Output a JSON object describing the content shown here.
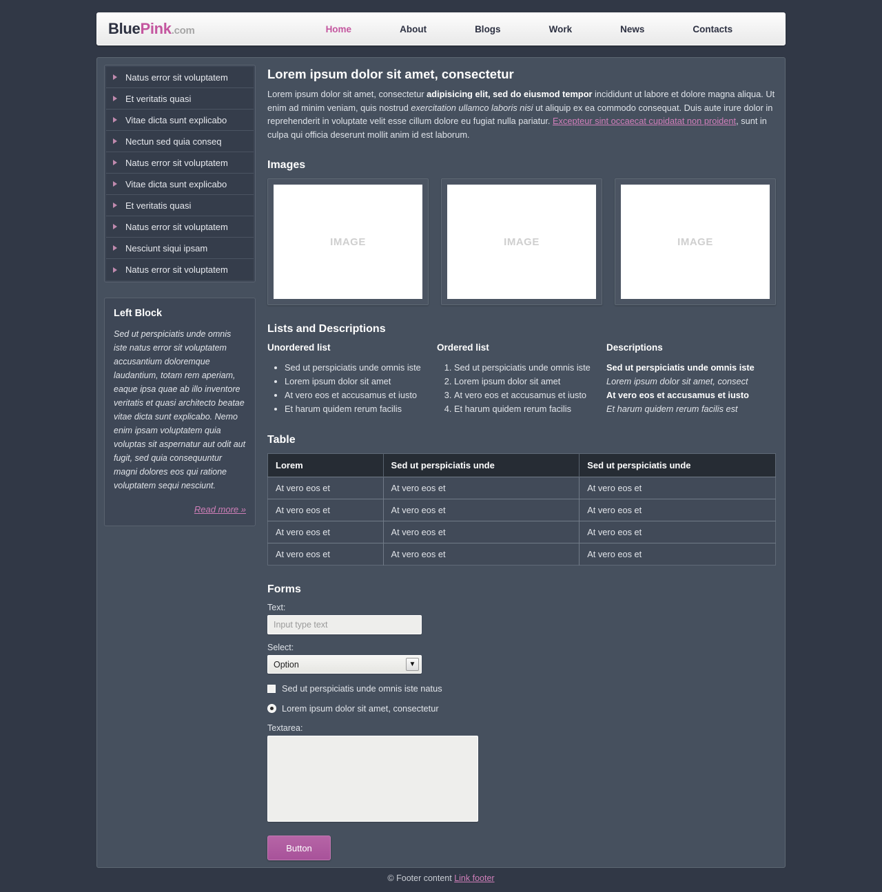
{
  "header": {
    "logo": {
      "blue": "Blue",
      "pink": "Pink",
      "com": ".com"
    },
    "nav": [
      {
        "label": "Home",
        "active": true
      },
      {
        "label": "About",
        "active": false
      },
      {
        "label": "Blogs",
        "active": false
      },
      {
        "label": "Work",
        "active": false
      },
      {
        "label": "News",
        "active": false
      },
      {
        "label": "Contacts",
        "active": false
      }
    ]
  },
  "sidebar": {
    "menu": [
      "Natus error sit voluptatem",
      "Et veritatis quasi",
      "Vitae dicta sunt explicabo",
      "Nectun sed quia conseq",
      "Natus error sit voluptatem",
      "Vitae dicta sunt explicabo",
      "Et veritatis quasi",
      "Natus error sit voluptatem",
      "Nesciunt siqui ipsam",
      "Natus error sit voluptatem"
    ],
    "left_block": {
      "title": "Left Block",
      "text": "Sed ut perspiciatis unde omnis iste natus error sit voluptatem accusantium doloremque laudantium, totam rem aperiam, eaque ipsa quae ab illo inventore veritatis et quasi architecto beatae vitae dicta sunt explicabo. Nemo enim ipsam voluptatem quia voluptas sit aspernatur aut odit aut fugit, sed quia consequuntur magni dolores eos qui ratione voluptatem sequi nesciunt.",
      "read_more": "Read more »"
    }
  },
  "content": {
    "title": "Lorem ipsum dolor sit amet, consectetur",
    "intro": {
      "part1": "Lorem ipsum dolor sit amet, consectetur ",
      "bold": "adipisicing elit, sed do eiusmod tempor",
      "part2": " incididunt ut labore et dolore magna aliqua. Ut enim ad minim veniam, quis nostrud ",
      "italic": "exercitation ullamco laboris nisi",
      "part3": " ut aliquip ex ea commodo consequat. Duis aute irure dolor in reprehenderit in voluptate velit esse cillum dolore eu fugiat nulla pariatur. ",
      "link": "Excepteur sint occaecat cupidatat non proident",
      "part4": ", sunt in culpa qui officia deserunt mollit anim id est laborum."
    },
    "images": {
      "heading": "Images",
      "items": [
        {
          "label": "IMAGE"
        },
        {
          "label": "IMAGE"
        },
        {
          "label": "IMAGE"
        }
      ]
    },
    "lists": {
      "heading": "Lists and Descriptions",
      "unordered": {
        "title": "Unordered list",
        "items": [
          "Sed ut perspiciatis unde omnis iste",
          "Lorem ipsum dolor sit amet",
          "At vero eos et accusamus et iusto",
          "Et harum quidem rerum facilis"
        ]
      },
      "ordered": {
        "title": "Ordered list",
        "items": [
          "Sed ut perspiciatis unde omnis iste",
          "Lorem ipsum dolor sit amet",
          "At vero eos et accusamus et iusto",
          "Et harum quidem rerum facilis"
        ]
      },
      "descriptions": {
        "title": "Descriptions",
        "items": [
          {
            "term": "Sed ut perspiciatis unde omnis iste",
            "def": "Lorem ipsum dolor sit amet, consect"
          },
          {
            "term": "At vero eos et accusamus et iusto",
            "def": "Et harum quidem rerum facilis est"
          }
        ]
      }
    },
    "table": {
      "heading": "Table",
      "columns": [
        "Lorem",
        "Sed ut perspiciatis unde",
        "Sed ut perspiciatis unde"
      ],
      "rows": [
        [
          "At vero eos et",
          "At vero eos et",
          "At vero eos et"
        ],
        [
          "At vero eos et",
          "At vero eos et",
          "At vero eos et"
        ],
        [
          "At vero eos et",
          "At vero eos et",
          "At vero eos et"
        ],
        [
          "At vero eos et",
          "At vero eos et",
          "At vero eos et"
        ]
      ]
    },
    "forms": {
      "heading": "Forms",
      "text_label": "Text:",
      "text_placeholder": "Input type text",
      "text_value": "",
      "select_label": "Select:",
      "select_value": "Option",
      "select_arrow": "▼",
      "checkbox_label": "Sed ut perspiciatis unde omnis iste natus",
      "checkbox_checked": false,
      "radio_label": "Lorem ipsum dolor sit amet, consectetur",
      "radio_checked": true,
      "textarea_label": "Textarea:",
      "textarea_value": "",
      "button_label": "Button"
    }
  },
  "footer": {
    "text": "© Footer content ",
    "link": "Link footer"
  },
  "colors": {
    "page_bg": "#313846",
    "panel_bg": "#46505e",
    "accent_pink": "#c4569f",
    "link_pink": "#d07fba",
    "table_header": "#262c34"
  }
}
